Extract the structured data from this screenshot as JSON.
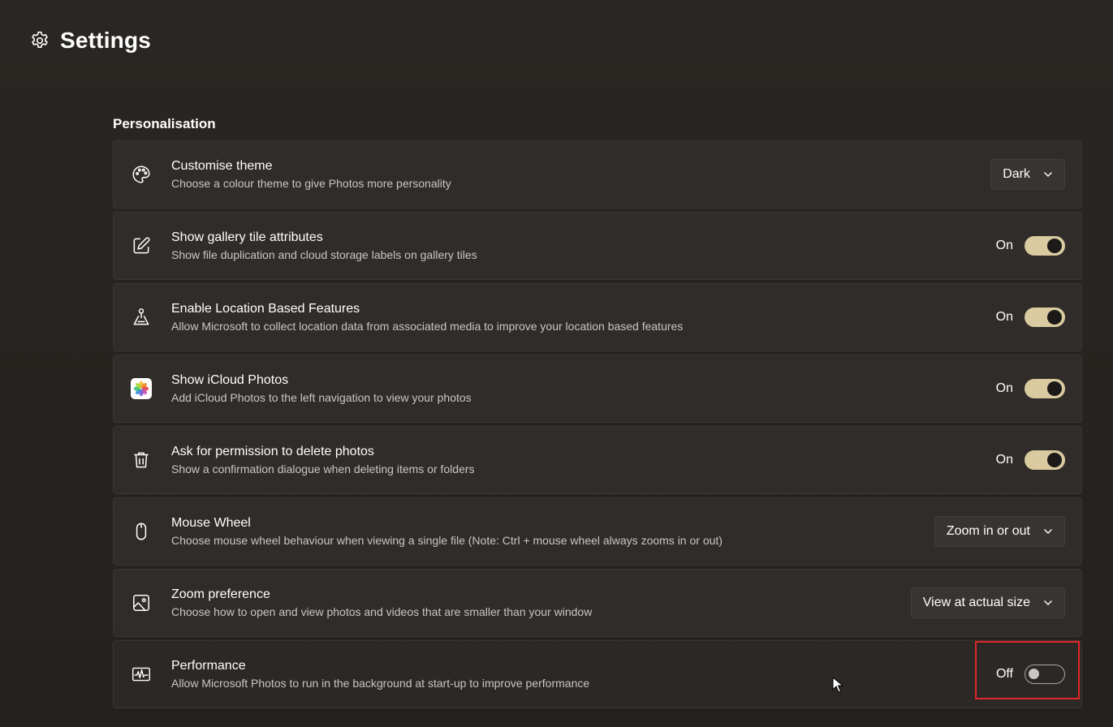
{
  "header": {
    "title": "Settings",
    "icon": "gear-icon"
  },
  "section": {
    "title": "Personalisation"
  },
  "settings": [
    {
      "icon": "palette-icon",
      "label": "Customise theme",
      "desc": "Choose a colour theme to give Photos more personality",
      "control": "dropdown",
      "value": "Dark"
    },
    {
      "icon": "edit-icon",
      "label": "Show gallery tile attributes",
      "desc": "Show file duplication and cloud storage labels on gallery tiles",
      "control": "toggle",
      "state": "On"
    },
    {
      "icon": "location-icon",
      "label": "Enable Location Based Features",
      "desc": "Allow Microsoft to collect location data from associated media to improve your location based features",
      "control": "toggle",
      "state": "On"
    },
    {
      "icon": "icloud-photos-icon",
      "label": "Show iCloud Photos",
      "desc": "Add iCloud Photos to the left navigation to view your photos",
      "control": "toggle",
      "state": "On"
    },
    {
      "icon": "trash-icon",
      "label": "Ask for permission to delete photos",
      "desc": "Show a confirmation dialogue when deleting items or folders",
      "control": "toggle",
      "state": "On"
    },
    {
      "icon": "mouse-icon",
      "label": "Mouse Wheel",
      "desc": "Choose mouse wheel behaviour when viewing a single file (Note: Ctrl + mouse wheel always zooms in or out)",
      "control": "dropdown",
      "value": "Zoom in or out"
    },
    {
      "icon": "image-icon",
      "label": "Zoom preference",
      "desc": "Choose how to open and view photos and videos that are smaller than your window",
      "control": "dropdown",
      "value": "View at actual size"
    },
    {
      "icon": "performance-icon",
      "label": "Performance",
      "desc": "Allow Microsoft Photos to run in the background at start-up to improve performance",
      "control": "toggle",
      "state": "Off"
    }
  ],
  "colors": {
    "toggle_on": "#d9caa0",
    "highlight": "#e0262a",
    "card_bg": "#302c29",
    "page_bg": "#221f1c"
  }
}
